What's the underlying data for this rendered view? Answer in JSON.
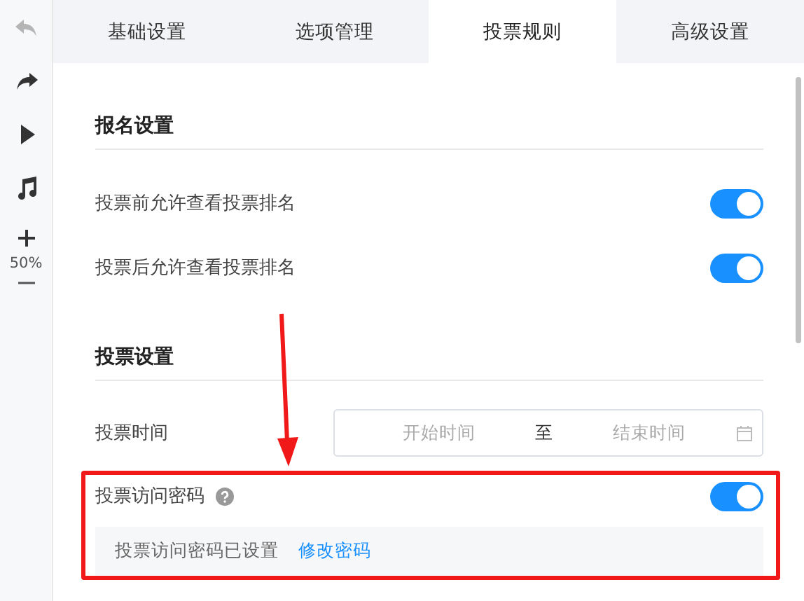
{
  "toolbar": {
    "buttons": [
      {
        "kind": "undo",
        "disabled": true
      },
      {
        "kind": "redo",
        "disabled": false
      },
      {
        "kind": "play",
        "disabled": false
      },
      {
        "kind": "music",
        "disabled": false
      }
    ],
    "zoom": "50%"
  },
  "tabs": [
    {
      "label": "基础设置",
      "selected": false
    },
    {
      "label": "选项管理",
      "selected": false
    },
    {
      "label": "投票规则",
      "selected": true
    },
    {
      "label": "高级设置",
      "selected": false
    }
  ],
  "sections": [
    {
      "title": "报名设置",
      "rows": [
        {
          "kind": "toggle",
          "label": "投票前允许查看投票排名",
          "on": true
        },
        {
          "kind": "toggle",
          "label": "投票后允许查看投票排名",
          "on": true
        }
      ]
    },
    {
      "title": "投票设置",
      "rows": [
        {
          "kind": "date-range",
          "label": "投票时间",
          "start_placeholder": "开始时间",
          "separator": "至",
          "end_placeholder": "结束时间"
        },
        {
          "kind": "toggle",
          "label": "投票访问密码",
          "help": true,
          "on": true,
          "note": {
            "text": "投票访问密码已设置",
            "link": "修改密码"
          }
        }
      ]
    }
  ]
}
